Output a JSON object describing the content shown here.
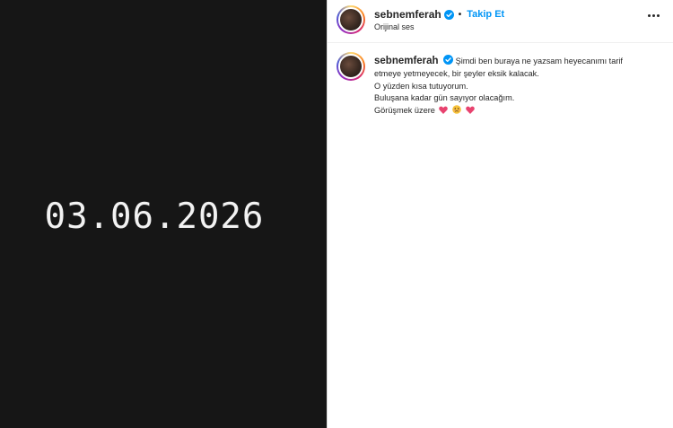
{
  "media": {
    "text": "03.06.2026"
  },
  "header": {
    "username": "sebnemferah",
    "separator": "•",
    "follow_label": "Takip Et",
    "audio_label": "Orijinal ses"
  },
  "caption": {
    "username": "sebnemferah",
    "line1": "Şimdi ben buraya ne yazsam heyecanımı tarif",
    "line2": "etmeye yetmeyecek, bir şeyler eksik kalacak.",
    "line3": "O yüzden kısa tutuyorum.",
    "line4": "Buluşana kadar gün sayıyor olacağım.",
    "line5": "Görüşmek üzere"
  },
  "colors": {
    "accent": "#0095f6",
    "verified": "#0095f6",
    "heart": "#e8436f",
    "media_bg": "#161616"
  },
  "icons": [
    "verified-icon",
    "more-options-icon",
    "heart-emoji-icon",
    "face-emoji-icon"
  ]
}
